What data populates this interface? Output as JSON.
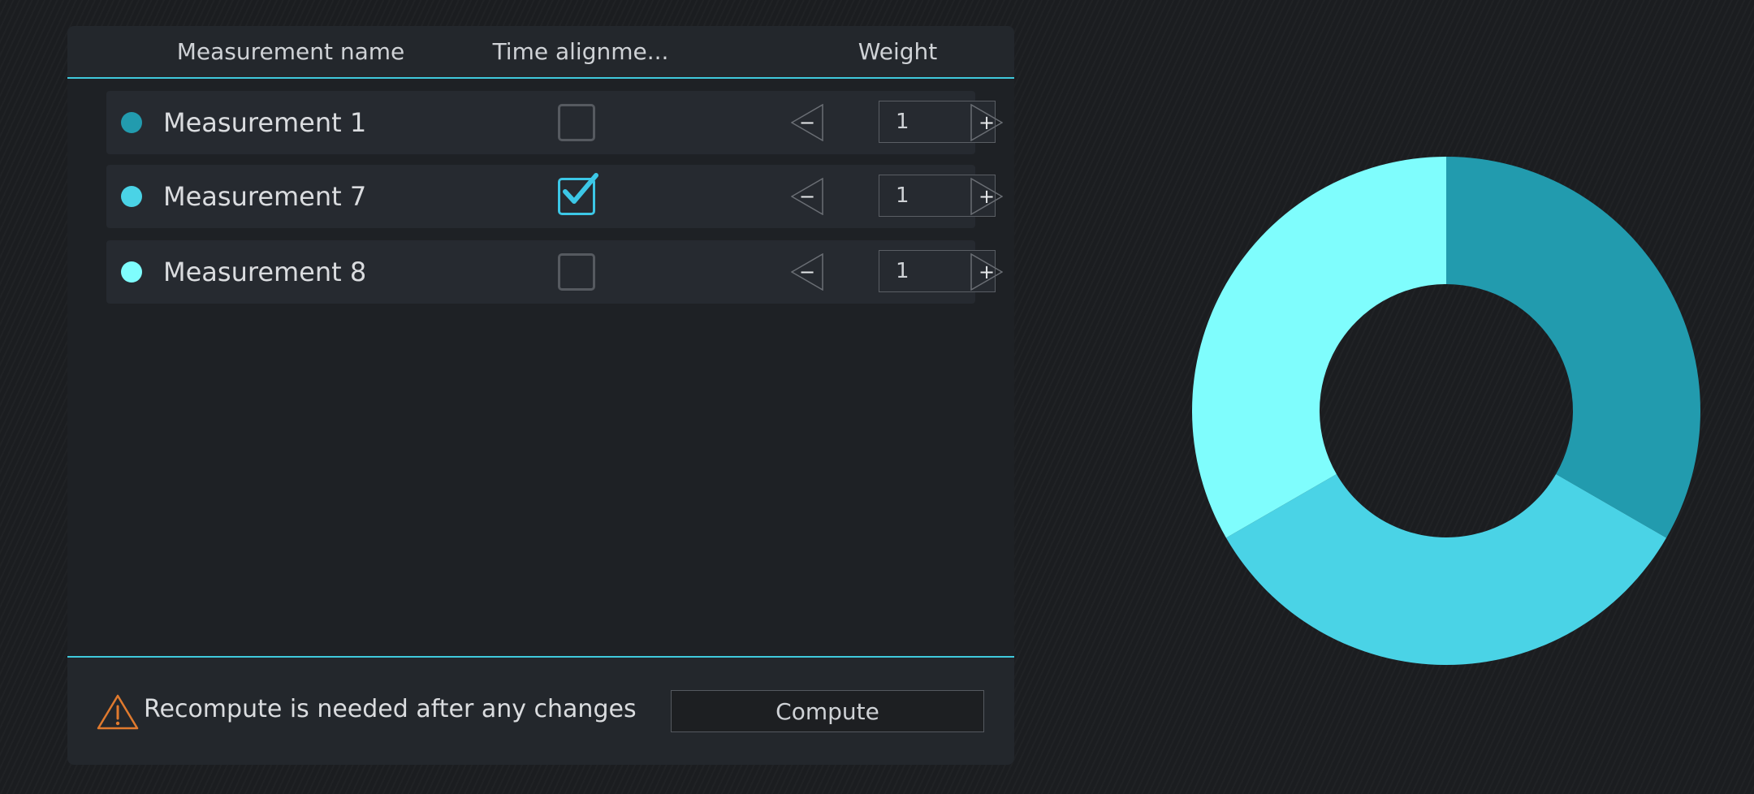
{
  "table": {
    "columns": [
      "Measurement name",
      "Time alignme...",
      "Weight"
    ],
    "rows": [
      {
        "name": "Measurement 1",
        "time_alignment": false,
        "weight": "1",
        "color": "#229bae"
      },
      {
        "name": "Measurement 7",
        "time_alignment": true,
        "weight": "1",
        "color": "#4ad3e6"
      },
      {
        "name": "Measurement 8",
        "time_alignment": false,
        "weight": "1",
        "color": "#7ffdfd"
      }
    ],
    "decrement_glyph": "−",
    "increment_glyph": "+"
  },
  "footer": {
    "warning": "Recompute is needed after any changes",
    "compute_label": "Compute",
    "warning_color": "#e07a2e"
  },
  "colors": {
    "accent": "#3fc9dc",
    "check": "#3cc7e6"
  },
  "chart_data": {
    "type": "pie",
    "donut": true,
    "labels": [
      "Measurement 1",
      "Measurement 7",
      "Measurement 8"
    ],
    "values": [
      1,
      1,
      1
    ],
    "colors": [
      "#229bae",
      "#4ad3e6",
      "#7ffdfd"
    ]
  }
}
